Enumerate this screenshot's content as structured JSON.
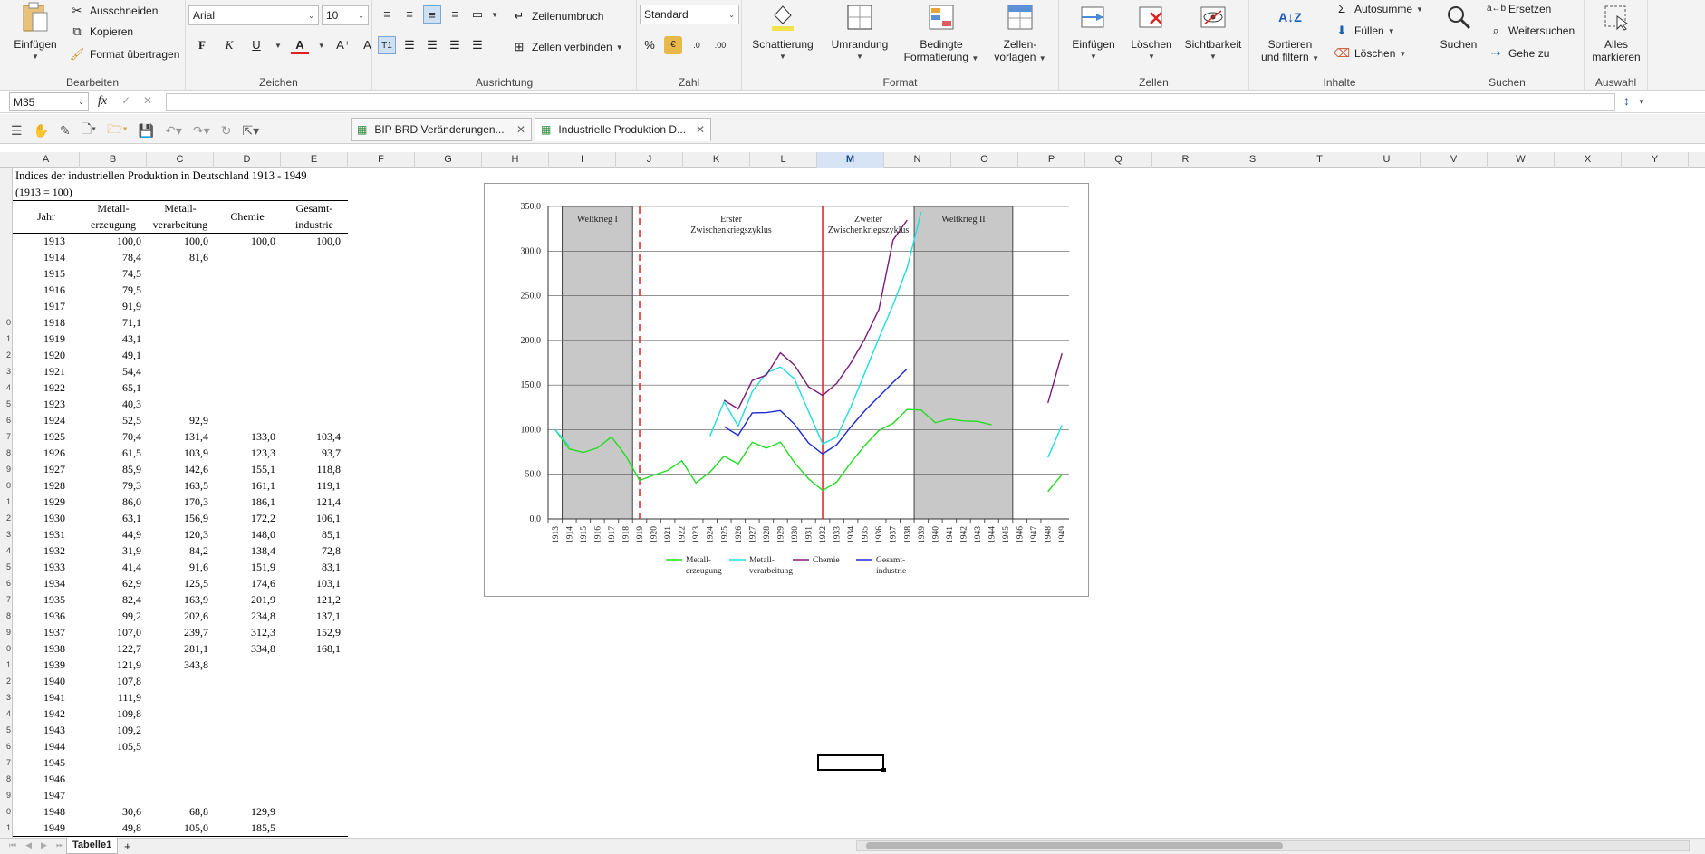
{
  "ribbon": {
    "clipboard": {
      "paste": "Einfügen",
      "cut": "Ausschneiden",
      "copy": "Kopieren",
      "format_painter": "Format übertragen",
      "label": "Bearbeiten"
    },
    "font": {
      "family": "Arial",
      "size": "10",
      "label": "Zeichen"
    },
    "alignment": {
      "wrap": "Zeilenumbruch",
      "merge": "Zellen verbinden",
      "label": "Ausrichtung"
    },
    "number": {
      "format": "Standard",
      "label": "Zahl"
    },
    "styles": {
      "shading": "Schattierung",
      "border": "Umrandung",
      "conditional_1": "Bedingte",
      "conditional_2": "Formatierung",
      "cell_styles_1": "Zellen-",
      "cell_styles_2": "vorlagen",
      "label": "Format"
    },
    "cells": {
      "insert": "Einfügen",
      "delete": "Löschen",
      "visibility": "Sichtbarkeit",
      "label": "Zellen"
    },
    "editing": {
      "sort_1": "Sortieren",
      "sort_2": "und filtern",
      "autosum": "Autosumme",
      "fill": "Füllen",
      "clear": "Löschen",
      "label": "Inhalte"
    },
    "find": {
      "search": "Suchen",
      "replace": "Ersetzen",
      "find_next": "Weitersuchen",
      "goto": "Gehe zu",
      "label": "Suchen"
    },
    "select": {
      "select_all_1": "Alles",
      "select_all_2": "markieren",
      "label": "Auswahl"
    }
  },
  "formula_bar": {
    "name_box": "M35",
    "fx": "fx",
    "value": ""
  },
  "doc_tabs": [
    {
      "label": "BIP BRD Veränderungen..."
    },
    {
      "label": "Industrielle Produktion D..."
    }
  ],
  "columns": [
    "A",
    "B",
    "C",
    "D",
    "E",
    "F",
    "G",
    "H",
    "I",
    "J",
    "K",
    "L",
    "M",
    "N",
    "O",
    "P",
    "Q",
    "R",
    "S",
    "T",
    "U",
    "V",
    "W",
    "X",
    "Y"
  ],
  "active_column": "M",
  "row_numbers": [
    "",
    "",
    "",
    "",
    "",
    "",
    "",
    "",
    "",
    "0",
    "1",
    "2",
    "3",
    "4",
    "5",
    "6",
    "7",
    "8",
    "9",
    "0",
    "1",
    "2",
    "3",
    "4",
    "5",
    "6",
    "7",
    "8",
    "9",
    "0",
    "1",
    "2",
    "3",
    "4",
    "5",
    "6",
    "7",
    "8",
    "9",
    "0",
    "1",
    "2",
    "3",
    "4"
  ],
  "sheet": {
    "title_1": "Indices der industriellen Produktion in Deutschland 1913 - 1949",
    "title_2": "(1913 = 100)",
    "headers": {
      "year": "Jahr",
      "metal_prod_1": "Metall-",
      "metal_prod_2": "erzeugung",
      "metal_proc_1": "Metall-",
      "metal_proc_2": "verarbeitung",
      "chem": "Chemie",
      "total_1": "Gesamt-",
      "total_2": "industrie"
    },
    "rows": [
      [
        "1913",
        "100,0",
        "100,0",
        "100,0",
        "100,0"
      ],
      [
        "1914",
        "78,4",
        "81,6",
        "",
        ""
      ],
      [
        "1915",
        "74,5",
        "",
        "",
        ""
      ],
      [
        "1916",
        "79,5",
        "",
        "",
        ""
      ],
      [
        "1917",
        "91,9",
        "",
        "",
        ""
      ],
      [
        "1918",
        "71,1",
        "",
        "",
        ""
      ],
      [
        "1919",
        "43,1",
        "",
        "",
        ""
      ],
      [
        "1920",
        "49,1",
        "",
        "",
        ""
      ],
      [
        "1921",
        "54,4",
        "",
        "",
        ""
      ],
      [
        "1922",
        "65,1",
        "",
        "",
        ""
      ],
      [
        "1923",
        "40,3",
        "",
        "",
        ""
      ],
      [
        "1924",
        "52,5",
        "92,9",
        "",
        ""
      ],
      [
        "1925",
        "70,4",
        "131,4",
        "133,0",
        "103,4"
      ],
      [
        "1926",
        "61,5",
        "103,9",
        "123,3",
        "93,7"
      ],
      [
        "1927",
        "85,9",
        "142,6",
        "155,1",
        "118,8"
      ],
      [
        "1928",
        "79,3",
        "163,5",
        "161,1",
        "119,1"
      ],
      [
        "1929",
        "86,0",
        "170,3",
        "186,1",
        "121,4"
      ],
      [
        "1930",
        "63,1",
        "156,9",
        "172,2",
        "106,1"
      ],
      [
        "1931",
        "44,9",
        "120,3",
        "148,0",
        "85,1"
      ],
      [
        "1932",
        "31,9",
        "84,2",
        "138,4",
        "72,8"
      ],
      [
        "1933",
        "41,4",
        "91,6",
        "151,9",
        "83,1"
      ],
      [
        "1934",
        "62,9",
        "125,5",
        "174,6",
        "103,1"
      ],
      [
        "1935",
        "82,4",
        "163,9",
        "201,9",
        "121,2"
      ],
      [
        "1936",
        "99,2",
        "202,6",
        "234,8",
        "137,1"
      ],
      [
        "1937",
        "107,0",
        "239,7",
        "312,3",
        "152,9"
      ],
      [
        "1938",
        "122,7",
        "281,1",
        "334,8",
        "168,1"
      ],
      [
        "1939",
        "121,9",
        "343,8",
        "",
        ""
      ],
      [
        "1940",
        "107,8",
        "",
        "",
        ""
      ],
      [
        "1941",
        "111,9",
        "",
        "",
        ""
      ],
      [
        "1942",
        "109,8",
        "",
        "",
        ""
      ],
      [
        "1943",
        "109,2",
        "",
        "",
        ""
      ],
      [
        "1944",
        "105,5",
        "",
        "",
        ""
      ],
      [
        "1945",
        "",
        "",
        "",
        ""
      ],
      [
        "1946",
        "",
        "",
        "",
        ""
      ],
      [
        "1947",
        "",
        "",
        "",
        ""
      ],
      [
        "1948",
        "30,6",
        "68,8",
        "129,9",
        ""
      ],
      [
        "1949",
        "49,8",
        "105,0",
        "185,5",
        ""
      ]
    ]
  },
  "chart_data": {
    "type": "line",
    "x": [
      "1913",
      "1914",
      "1915",
      "1916",
      "1917",
      "1918",
      "1919",
      "1920",
      "1921",
      "1922",
      "1923",
      "1924",
      "1925",
      "1926",
      "1927",
      "1928",
      "1929",
      "1930",
      "1931",
      "1932",
      "1933",
      "1934",
      "1935",
      "1936",
      "1937",
      "1938",
      "1939",
      "1940",
      "1941",
      "1942",
      "1943",
      "1944",
      "1945",
      "1946",
      "1947",
      "1948",
      "1949"
    ],
    "ylim": [
      0,
      350
    ],
    "yticks": [
      "0,0",
      "50,0",
      "100,0",
      "150,0",
      "200,0",
      "250,0",
      "300,0",
      "350,0"
    ],
    "grid": true,
    "legend_position": "bottom",
    "series": [
      {
        "name": "Metall-erzeugung",
        "label_1": "Metall-",
        "label_2": "erzeugung",
        "color": "#22dd22",
        "values": [
          100.0,
          78.4,
          74.5,
          79.5,
          91.9,
          71.1,
          43.1,
          49.1,
          54.4,
          65.1,
          40.3,
          52.5,
          70.4,
          61.5,
          85.9,
          79.3,
          86.0,
          63.1,
          44.9,
          31.9,
          41.4,
          62.9,
          82.4,
          99.2,
          107.0,
          122.7,
          121.9,
          107.8,
          111.9,
          109.8,
          109.2,
          105.5,
          null,
          null,
          null,
          30.6,
          49.8
        ]
      },
      {
        "name": "Metall-verarbeitung",
        "label_1": "Metall-",
        "label_2": "verarbeitung",
        "color": "#22dddd",
        "values": [
          100.0,
          81.6,
          null,
          null,
          null,
          null,
          null,
          null,
          null,
          null,
          null,
          92.9,
          131.4,
          103.9,
          142.6,
          163.5,
          170.3,
          156.9,
          120.3,
          84.2,
          91.6,
          125.5,
          163.9,
          202.6,
          239.7,
          281.1,
          343.8,
          null,
          null,
          null,
          null,
          null,
          null,
          null,
          null,
          68.8,
          105.0
        ]
      },
      {
        "name": "Chemie",
        "label_1": "Chemie",
        "label_2": "",
        "color": "#7a1a7a",
        "values": [
          100.0,
          null,
          null,
          null,
          null,
          null,
          null,
          null,
          null,
          null,
          null,
          null,
          133.0,
          123.3,
          155.1,
          161.1,
          186.1,
          172.2,
          148.0,
          138.4,
          151.9,
          174.6,
          201.9,
          234.8,
          312.3,
          334.8,
          null,
          null,
          null,
          null,
          null,
          null,
          null,
          null,
          null,
          129.9,
          185.5
        ]
      },
      {
        "name": "Gesamt-industrie",
        "label_1": "Gesamt-",
        "label_2": "industrie",
        "color": "#1a2ad4",
        "values": [
          100.0,
          null,
          null,
          null,
          null,
          null,
          null,
          null,
          null,
          null,
          null,
          null,
          103.4,
          93.7,
          118.8,
          119.1,
          121.4,
          106.1,
          85.1,
          72.8,
          83.1,
          103.1,
          121.2,
          137.1,
          152.9,
          168.1,
          null,
          null,
          null,
          null,
          null,
          null,
          null,
          null,
          null,
          null,
          null
        ]
      }
    ],
    "shaded_periods": [
      {
        "label": "Weltkrieg I",
        "from": "1914",
        "to": "1918"
      },
      {
        "label": "Weltkrieg II",
        "from": "1939",
        "to": "1945"
      }
    ],
    "annotations": {
      "cycle1_1": "Erster",
      "cycle1_2": "Zwischenkriegszyklus",
      "cycle2_1": "Zweiter",
      "cycle2_2": "Zwischenkriegszyklus"
    },
    "markers": [
      {
        "year": "1919",
        "style": "dashed",
        "color": "#dd2222"
      },
      {
        "year": "1932",
        "style": "solid",
        "color": "#dd2222"
      }
    ]
  },
  "bottom": {
    "sheet_tab": "Tabelle1",
    "add": "+"
  }
}
